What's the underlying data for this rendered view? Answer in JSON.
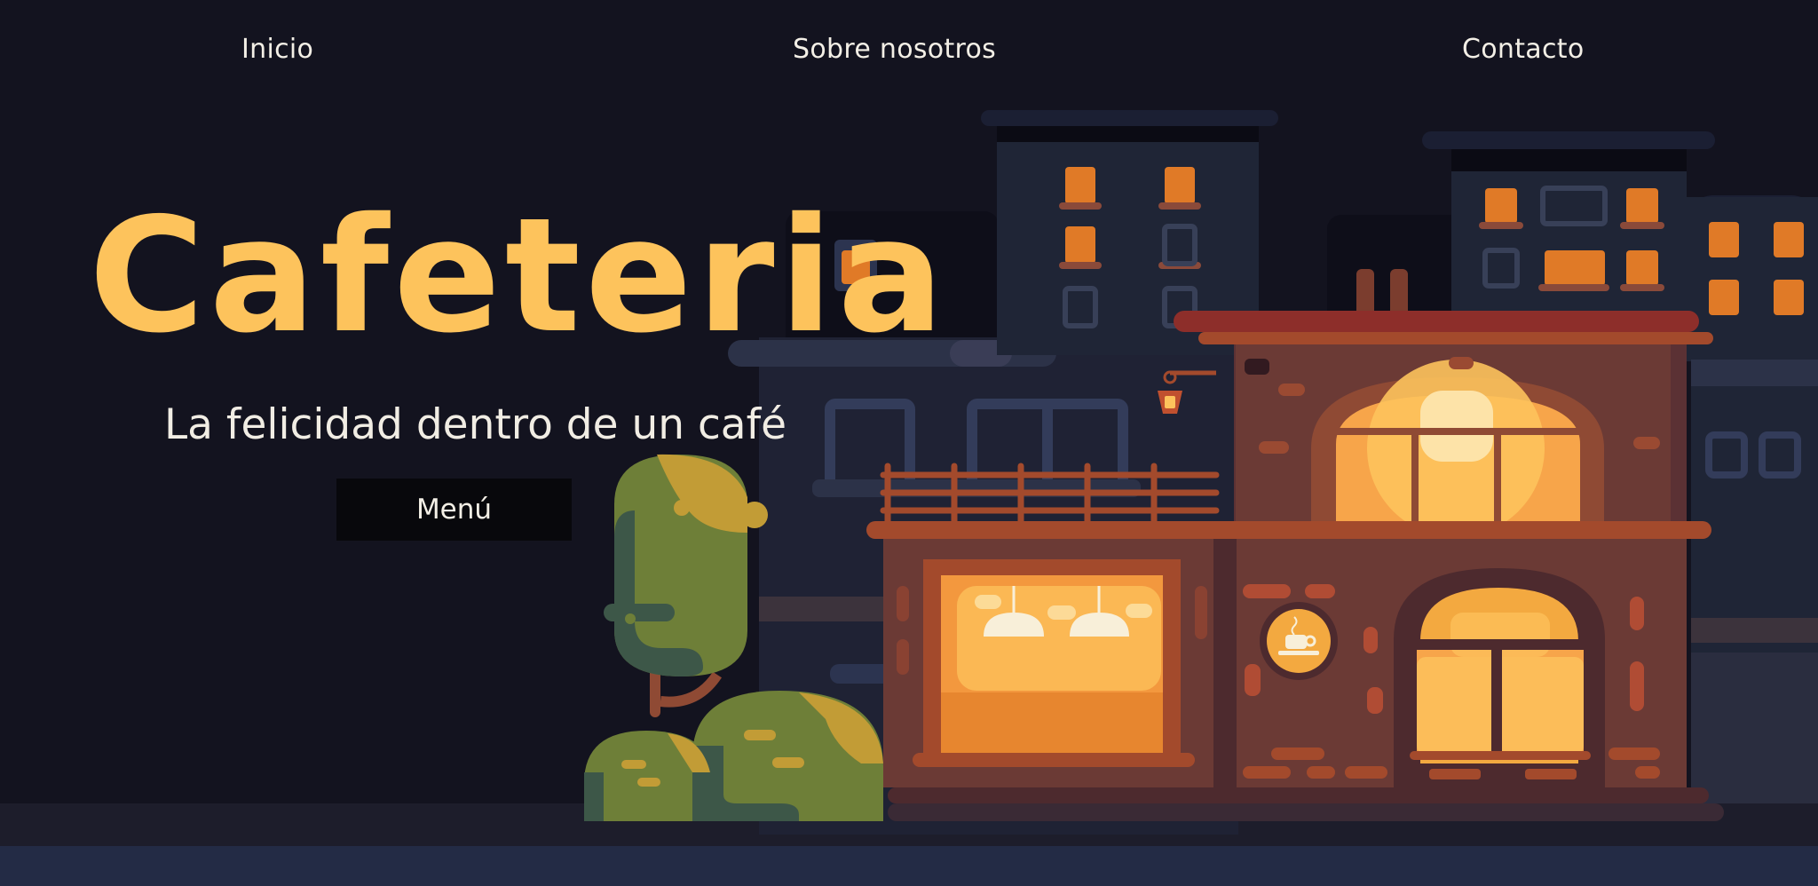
{
  "nav": {
    "items": [
      {
        "label": "Inicio"
      },
      {
        "label": "Sobre nosotros"
      },
      {
        "label": "Contacto"
      }
    ]
  },
  "hero": {
    "title": "Cafeteria",
    "subtitle": "La felicidad dentro de un café",
    "cta_label": "Menú"
  },
  "colors": {
    "background": "#13131f",
    "title": "#fdc35c",
    "text": "#f3efe6",
    "button_bg": "#08080c",
    "window_light": "#f7a54a",
    "brick": "#6b3a35"
  },
  "icons": [
    "coffee-cup-sign-icon",
    "street-lamp-icon"
  ]
}
